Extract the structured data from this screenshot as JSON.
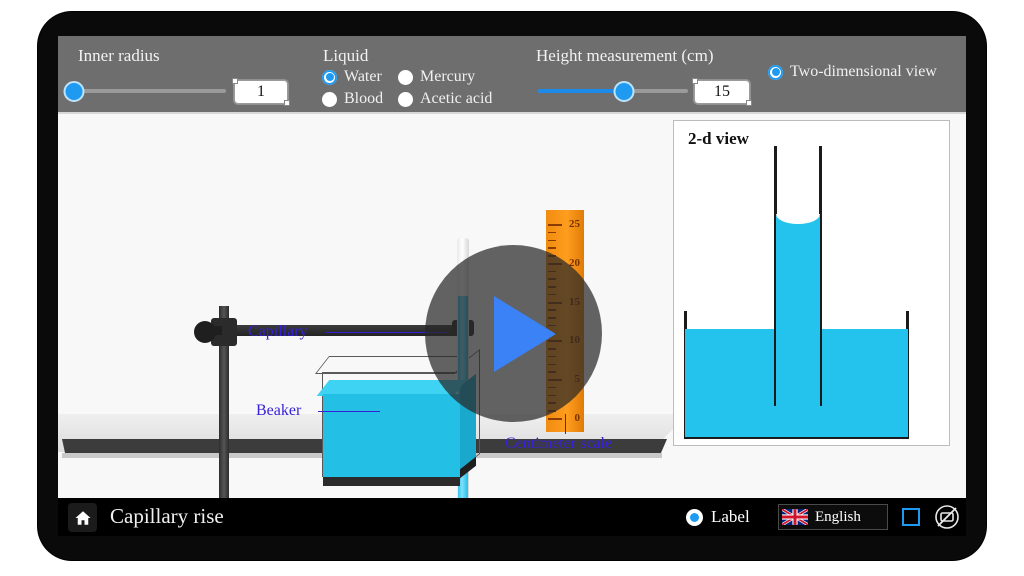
{
  "app": {
    "title": "Capillary rise",
    "home_icon": "home-icon"
  },
  "controls": {
    "inner_radius": {
      "label": "Inner radius",
      "value": "1",
      "slider_percent": 0,
      "min": 0,
      "max": 100
    },
    "liquid": {
      "label": "Liquid",
      "options": [
        {
          "label": "Water",
          "selected": true
        },
        {
          "label": "Mercury",
          "selected": false
        },
        {
          "label": "Blood",
          "selected": false
        },
        {
          "label": "Acetic acid",
          "selected": false
        }
      ]
    },
    "height_measurement": {
      "label": "Height measurement (cm)",
      "value": "15",
      "slider_percent": 57
    },
    "two_dimensional_view": {
      "label": "Two-dimensional view",
      "selected": true
    }
  },
  "scene": {
    "callouts": [
      {
        "text": "Capillary"
      },
      {
        "text": "Beaker"
      },
      {
        "text": "Centimeter scale"
      }
    ],
    "ruler": {
      "numbers": [
        "25",
        "20",
        "15",
        "10",
        "5",
        "0"
      ],
      "unit": "cm",
      "color": "#ff9d1f"
    },
    "play_button": {
      "icon": "play-icon"
    },
    "liquid_color": "#23bfe4"
  },
  "twod_view": {
    "title": "2-d view",
    "liquid_color": "#23c3ee"
  },
  "bottom_bar": {
    "label_toggle": {
      "label": "Label",
      "selected": true
    },
    "language": {
      "label": "English",
      "flag": "uk-flag-icon"
    },
    "fullscreen_icon": "fullscreen-icon",
    "rotate_lock_icon": "rotate-lock-icon"
  },
  "colors": {
    "accent": "#1e9bf0",
    "topbar": "#6e6e6e",
    "callout": "#3522d8",
    "ruler": "#ff9d1f"
  }
}
